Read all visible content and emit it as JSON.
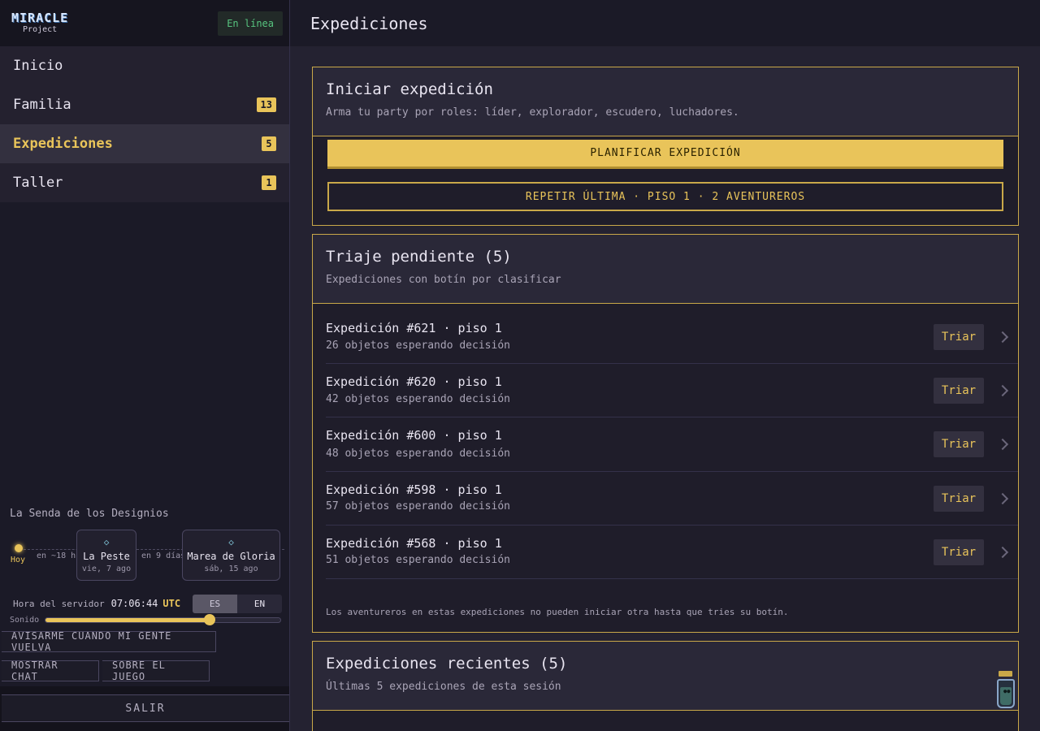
{
  "brand": {
    "logo_main": "MIRACLE",
    "logo_sub": "Project",
    "status": "En línea"
  },
  "nav": [
    {
      "label": "Inicio",
      "badge": ""
    },
    {
      "label": "Familia",
      "badge": "13"
    },
    {
      "label": "Expediciones",
      "badge": "5",
      "active": true
    },
    {
      "label": "Taller",
      "badge": "1"
    }
  ],
  "path": {
    "title": "La Senda de los Designios",
    "today": "Hoy",
    "gap1": "en ~18 h",
    "gap2": "en 9 días",
    "event1": {
      "name": "La Peste",
      "date": "vie, 7 ago",
      "icon": "diamond-icon"
    },
    "event2": {
      "name": "Marea de Gloria",
      "date": "sáb, 15 ago",
      "icon": "diamond-icon"
    }
  },
  "server": {
    "label": "Hora del servidor",
    "time": "07:06:44",
    "zone": "UTC",
    "lang_es": "ES",
    "lang_en": "EN",
    "lang_selected": "ES"
  },
  "sound": {
    "label": "Sonido",
    "level": 0.7
  },
  "options": {
    "notify": "AVISARME CUANDO MI GENTE VUELVA",
    "chat": "MOSTRAR CHAT",
    "about": "SOBRE EL JUEGO",
    "logout": "SALIR"
  },
  "main": {
    "title": "Expediciones",
    "start": {
      "title": "Iniciar expedición",
      "subtitle": "Arma tu party por roles: líder, explorador, escudero, luchadores.",
      "plan_label": "PLANIFICAR EXPEDICIÓN",
      "repeat_label": "REPETIR ÚLTIMA · PISO 1 · 2 AVENTUREROS"
    },
    "triage": {
      "title": "Triaje pendiente (5)",
      "subtitle": "Expediciones con botín por clasificar",
      "action_label": "Triar",
      "rows": [
        {
          "title": "Expedición #621 · piso 1",
          "sub": "26 objetos esperando decisión"
        },
        {
          "title": "Expedición #620 · piso 1",
          "sub": "42 objetos esperando decisión"
        },
        {
          "title": "Expedición #600 · piso 1",
          "sub": "48 objetos esperando decisión"
        },
        {
          "title": "Expedición #598 · piso 1",
          "sub": "57 objetos esperando decisión"
        },
        {
          "title": "Expedición #568 · piso 1",
          "sub": "51 objetos esperando decisión"
        }
      ],
      "footer": "Los aventureros en estas expediciones no pueden iniciar otra hasta que tries su botín."
    },
    "recent": {
      "title": "Expediciones recientes (5)",
      "subtitle": "Últimas 5 expediciones de esta sesión"
    }
  },
  "colors": {
    "accent": "#e9c45a",
    "online": "#57c47f",
    "background": "#242231"
  }
}
